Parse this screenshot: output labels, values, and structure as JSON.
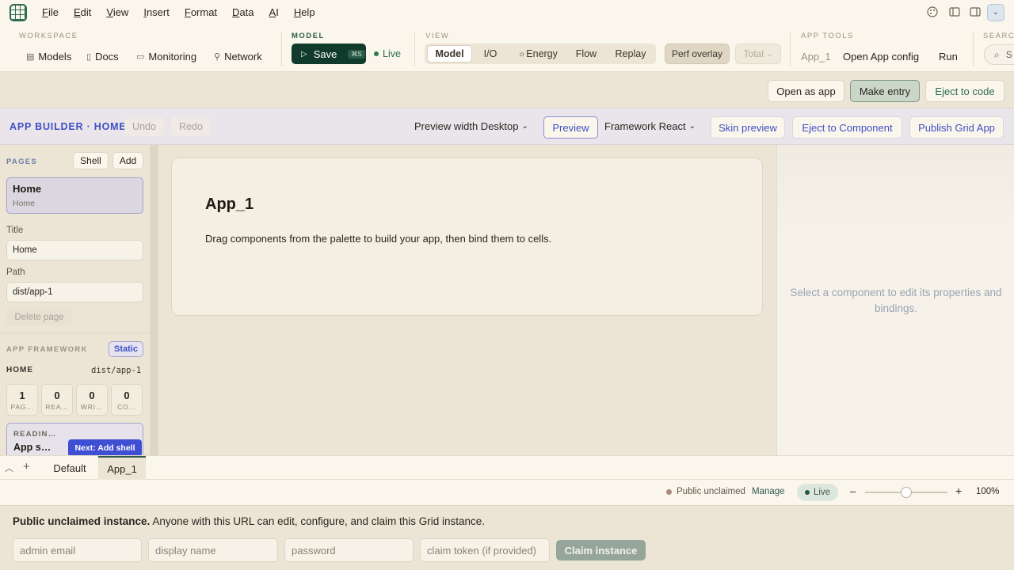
{
  "menubar": {
    "items": [
      "File",
      "Edit",
      "View",
      "Insert",
      "Format",
      "Data",
      "AI",
      "Help"
    ],
    "underline": [
      "F",
      "E",
      "V",
      "I",
      "F",
      "D",
      "A",
      "H"
    ]
  },
  "toolbar": {
    "workspace": {
      "label": "WORKSPACE",
      "items": [
        "Models",
        "Docs",
        "Monitoring",
        "Network"
      ]
    },
    "model": {
      "label": "MODEL",
      "save": "Save",
      "save_kbd": "⌘S",
      "live": "Live"
    },
    "view": {
      "label": "VIEW",
      "segments": [
        "Model",
        "I/O",
        "Energy",
        "Flow",
        "Replay"
      ],
      "active": "Model",
      "perf_overlay": "Perf overlay",
      "total": "Total"
    },
    "app_tools": {
      "label": "APP TOOLS",
      "app_name": "App_1",
      "open_config": "Open App config",
      "run": "Run"
    },
    "search": {
      "label": "SEARCH",
      "placeholder": "S"
    }
  },
  "actionbar": {
    "open_as_app": "Open as app",
    "make_entry": "Make entry",
    "eject_to_code": "Eject to code"
  },
  "builder": {
    "title": "APP BUILDER · HOME",
    "undo": "Undo",
    "redo": "Redo",
    "preview_width": "Preview width Desktop",
    "preview": "Preview",
    "framework": "Framework React",
    "skin_preview": "Skin preview",
    "eject_component": "Eject to Component",
    "publish": "Publish Grid App"
  },
  "pages": {
    "label": "PAGES",
    "shell": "Shell",
    "add": "Add",
    "current": {
      "title": "Home",
      "subtitle": "Home"
    },
    "title_label": "Title",
    "title_value": "Home",
    "path_label": "Path",
    "path_value": "dist/app-1",
    "delete": "Delete page"
  },
  "framework": {
    "label": "APP FRAMEWORK",
    "mode": "Static",
    "home_label": "HOME",
    "home_path": "dist/app-1",
    "stats": [
      {
        "n": "1",
        "l": "PAG…"
      },
      {
        "n": "0",
        "l": "REA…"
      },
      {
        "n": "0",
        "l": "WRI…"
      },
      {
        "n": "0",
        "l": "CO…"
      }
    ],
    "reading_label": "READIN…",
    "reading_title": "App s…",
    "next": "Next: Add shell"
  },
  "canvas": {
    "app_title": "App_1",
    "description": "Drag components from the palette to build your app, then bind them to cells."
  },
  "inspector": {
    "message": "Select a component to edit its properties and bindings."
  },
  "sheets": {
    "tabs": [
      "Default",
      "App_1"
    ],
    "active": "App_1"
  },
  "status": {
    "instance": "Public unclaimed",
    "manage": "Manage",
    "live": "Live",
    "zoom_minus": "–",
    "zoom_plus": "+",
    "zoom": "100%",
    "zoom_level": 0.5
  },
  "claim": {
    "heading": "Public unclaimed instance.",
    "text": " Anyone with this URL can edit, configure, and claim this Grid instance.",
    "admin_email": "admin email",
    "display_name": "display name",
    "password": "password",
    "claim_token": "claim token (if provided)",
    "button": "Claim instance"
  },
  "colors": {
    "accent_blue": "#3f4fc4",
    "brand_green": "#0f3a2c",
    "live_green": "#2d7a4a"
  }
}
